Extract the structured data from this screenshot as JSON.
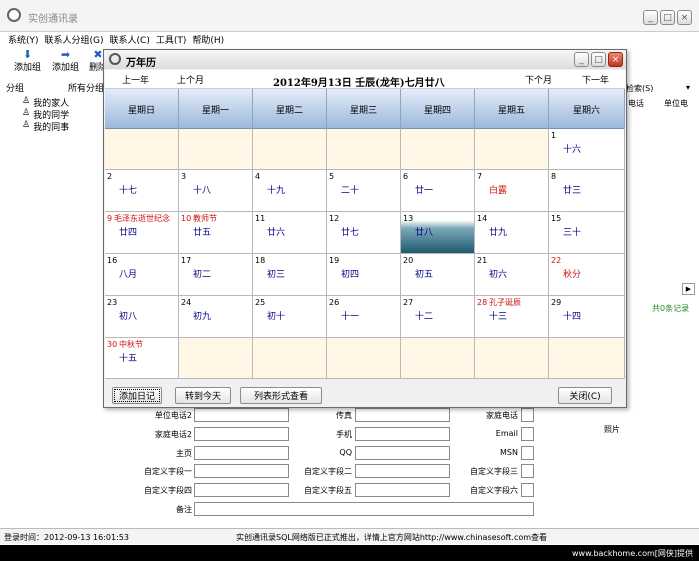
{
  "app": {
    "title": "实创通讯录"
  },
  "menu": [
    "系统(Y)",
    "联系人分组(G)",
    "联系人(C)",
    "工具(T)",
    "帮助(H)"
  ],
  "toolbar": {
    "add_group": "添加组",
    "add_group2": "添加组",
    "delete": "删除"
  },
  "groups": {
    "header_group": "分组",
    "header_all": "所有分组",
    "items": [
      "我的家人",
      "我的同学",
      "我的同事"
    ]
  },
  "search": {
    "label": "检索(S)"
  },
  "columns": [
    "电话",
    "单位电"
  ],
  "records": "共0条记录",
  "form": {
    "labels_left": [
      "单位电话2",
      "家庭电话2",
      "主页",
      "自定义字段一",
      "自定义字段四",
      "备注"
    ],
    "labels_mid": [
      "传真",
      "手机",
      "QQ",
      "自定义字段二",
      "自定义字段五"
    ],
    "labels_right": [
      "家庭电话",
      "Email",
      "MSN",
      "自定义字段三",
      "自定义字段六"
    ],
    "photo": "照片"
  },
  "status": {
    "login": "登录时间：2012-09-13 16:01:53",
    "notice": "实创通讯录SQL网络版已正式推出，详情上官方网站http://www.chinasesoft.com查看"
  },
  "watermark": "www.backhome.com[网侠]提供",
  "calendar": {
    "title": "万年历",
    "prev_year": "上一年",
    "prev_month": "上个月",
    "next_month": "下个月",
    "next_year": "下一年",
    "date_title": "2012年9月13日  壬辰(龙年)七月廿八",
    "weekdays": [
      "星期日",
      "星期一",
      "星期二",
      "星期三",
      "星期四",
      "星期五",
      "星期六"
    ],
    "cells": [
      {
        "d": "",
        "l": "",
        "e": ""
      },
      {
        "d": "",
        "l": "",
        "e": ""
      },
      {
        "d": "",
        "l": "",
        "e": ""
      },
      {
        "d": "",
        "l": "",
        "e": ""
      },
      {
        "d": "",
        "l": "",
        "e": ""
      },
      {
        "d": "",
        "l": "",
        "e": ""
      },
      {
        "d": "1",
        "l": "十六",
        "e": ""
      },
      {
        "d": "2",
        "l": "十七",
        "e": ""
      },
      {
        "d": "3",
        "l": "十八",
        "e": ""
      },
      {
        "d": "4",
        "l": "十九",
        "e": ""
      },
      {
        "d": "5",
        "l": "二十",
        "e": ""
      },
      {
        "d": "6",
        "l": "廿一",
        "e": ""
      },
      {
        "d": "7",
        "l": "白露",
        "e": "",
        "red": true
      },
      {
        "d": "8",
        "l": "廿三",
        "e": ""
      },
      {
        "d": "9",
        "l": "廿四",
        "e": "毛泽东逝世纪念",
        "dred": true
      },
      {
        "d": "10",
        "l": "廿五",
        "e": "教师节",
        "dred": true
      },
      {
        "d": "11",
        "l": "廿六",
        "e": ""
      },
      {
        "d": "12",
        "l": "廿七",
        "e": ""
      },
      {
        "d": "13",
        "l": "廿八",
        "e": "",
        "today": true
      },
      {
        "d": "14",
        "l": "廿九",
        "e": ""
      },
      {
        "d": "15",
        "l": "三十",
        "e": ""
      },
      {
        "d": "16",
        "l": "八月",
        "e": ""
      },
      {
        "d": "17",
        "l": "初二",
        "e": ""
      },
      {
        "d": "18",
        "l": "初三",
        "e": ""
      },
      {
        "d": "19",
        "l": "初四",
        "e": ""
      },
      {
        "d": "20",
        "l": "初五",
        "e": ""
      },
      {
        "d": "21",
        "l": "初六",
        "e": ""
      },
      {
        "d": "22",
        "l": "秋分",
        "e": "",
        "red": true,
        "dred": true
      },
      {
        "d": "23",
        "l": "初八",
        "e": ""
      },
      {
        "d": "24",
        "l": "初九",
        "e": ""
      },
      {
        "d": "25",
        "l": "初十",
        "e": ""
      },
      {
        "d": "26",
        "l": "十一",
        "e": ""
      },
      {
        "d": "27",
        "l": "十二",
        "e": ""
      },
      {
        "d": "28",
        "l": "十三",
        "e": "孔子诞辰",
        "dred": true
      },
      {
        "d": "29",
        "l": "十四",
        "e": ""
      },
      {
        "d": "30",
        "l": "十五",
        "e": "中秋节",
        "dred": true
      },
      {
        "d": "",
        "l": "",
        "e": ""
      },
      {
        "d": "",
        "l": "",
        "e": ""
      },
      {
        "d": "",
        "l": "",
        "e": ""
      },
      {
        "d": "",
        "l": "",
        "e": ""
      },
      {
        "d": "",
        "l": "",
        "e": ""
      },
      {
        "d": "",
        "l": "",
        "e": ""
      }
    ],
    "btn_add_diary": "添加日记",
    "btn_today": "转到今天",
    "btn_list": "列表形式查看",
    "btn_close": "关闭(C)"
  }
}
